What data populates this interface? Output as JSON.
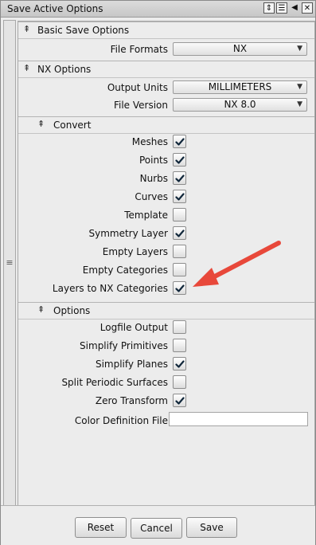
{
  "window": {
    "title": "Save Active Options",
    "title_icons": [
      "pin-icon",
      "list-icon",
      "collapse-left-icon",
      "close-icon"
    ]
  },
  "sections": {
    "basic": {
      "title": "Basic Save Options",
      "file_formats_label": "File Formats",
      "file_formats_value": "NX"
    },
    "nx": {
      "title": "NX Options",
      "output_units_label": "Output Units",
      "output_units_value": "MILLIMETERS",
      "file_version_label": "File Version",
      "file_version_value": "NX 8.0"
    },
    "convert": {
      "title": "Convert",
      "items": [
        {
          "label": "Meshes",
          "checked": true
        },
        {
          "label": "Points",
          "checked": true
        },
        {
          "label": "Nurbs",
          "checked": true
        },
        {
          "label": "Curves",
          "checked": true
        },
        {
          "label": "Template",
          "checked": false
        },
        {
          "label": "Symmetry Layer",
          "checked": true
        },
        {
          "label": "Empty Layers",
          "checked": false
        },
        {
          "label": "Empty Categories",
          "checked": false
        },
        {
          "label": "Layers to NX Categories",
          "checked": true
        }
      ]
    },
    "options": {
      "title": "Options",
      "items": [
        {
          "label": "Logfile Output",
          "checked": false
        },
        {
          "label": "Simplify Primitives",
          "checked": false
        },
        {
          "label": "Simplify Planes",
          "checked": true
        },
        {
          "label": "Split Periodic Surfaces",
          "checked": false
        },
        {
          "label": "Zero Transform",
          "checked": true
        }
      ],
      "color_definition_label": "Color Definition File",
      "color_definition_value": ""
    }
  },
  "footer": {
    "reset": "Reset",
    "cancel": "Cancel",
    "save": "Save"
  },
  "colors": {
    "annotation_arrow": "#e8483a"
  }
}
